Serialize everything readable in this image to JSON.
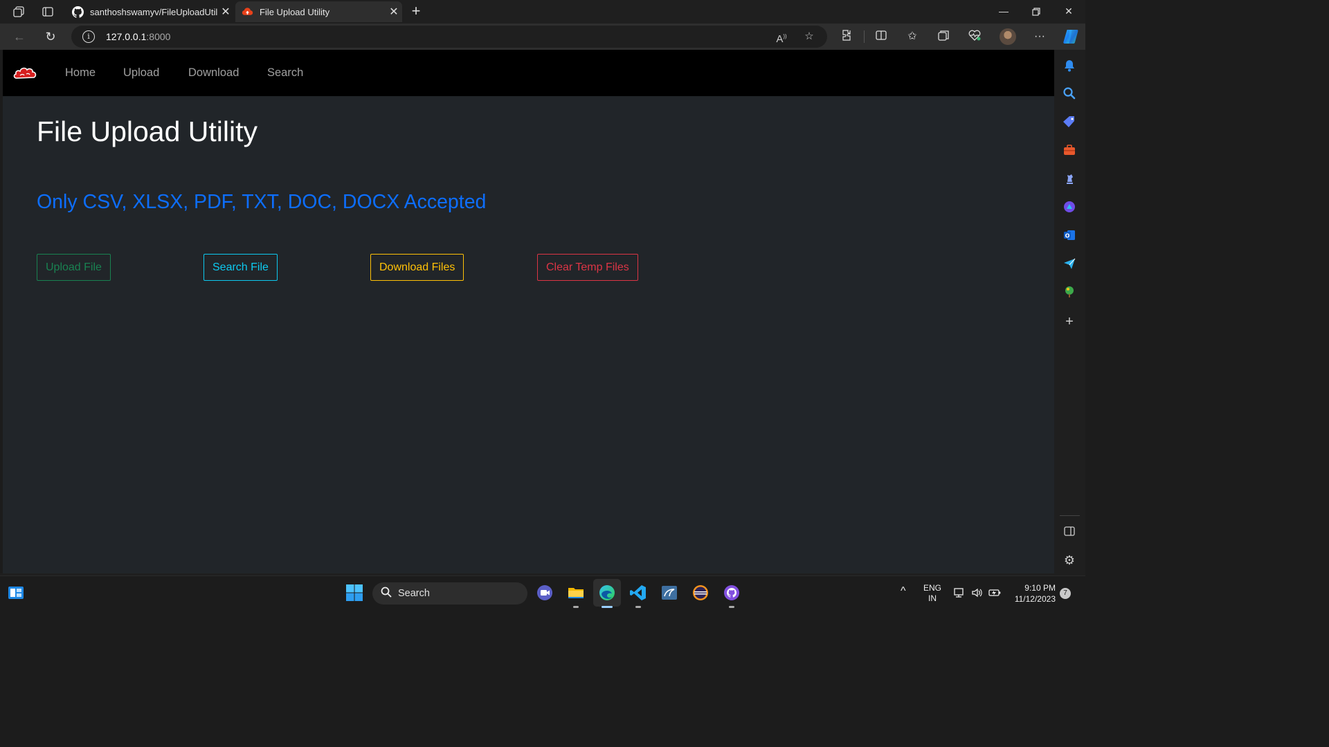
{
  "browser": {
    "tabs": [
      {
        "title": "santhoshswamyv/FileUploadUtility",
        "active": false,
        "icon": "github-icon"
      },
      {
        "title": "File Upload Utility",
        "active": true,
        "icon": "cloud-upload-icon"
      }
    ],
    "url_host": "127.0.0.1",
    "url_port": ":8000"
  },
  "site": {
    "nav_links": [
      "Home",
      "Upload",
      "Download",
      "Search"
    ],
    "title": "File Upload Utility",
    "accepted_note": "Only CSV, XLSX, PDF, TXT, DOC, DOCX Accepted",
    "buttons": {
      "upload": "Upload File",
      "search": "Search File",
      "download": "Download Files",
      "clear": "Clear Temp Files"
    },
    "colors": {
      "upload": "#198754",
      "search": "#0dcaf0",
      "download": "#ffc107",
      "clear": "#dc3545",
      "accent": "#0d6efd"
    }
  },
  "taskbar": {
    "search_label": "Search",
    "lang_line1": "ENG",
    "lang_line2": "IN",
    "time": "9:10 PM",
    "date": "11/12/2023",
    "notification_count": "7"
  }
}
